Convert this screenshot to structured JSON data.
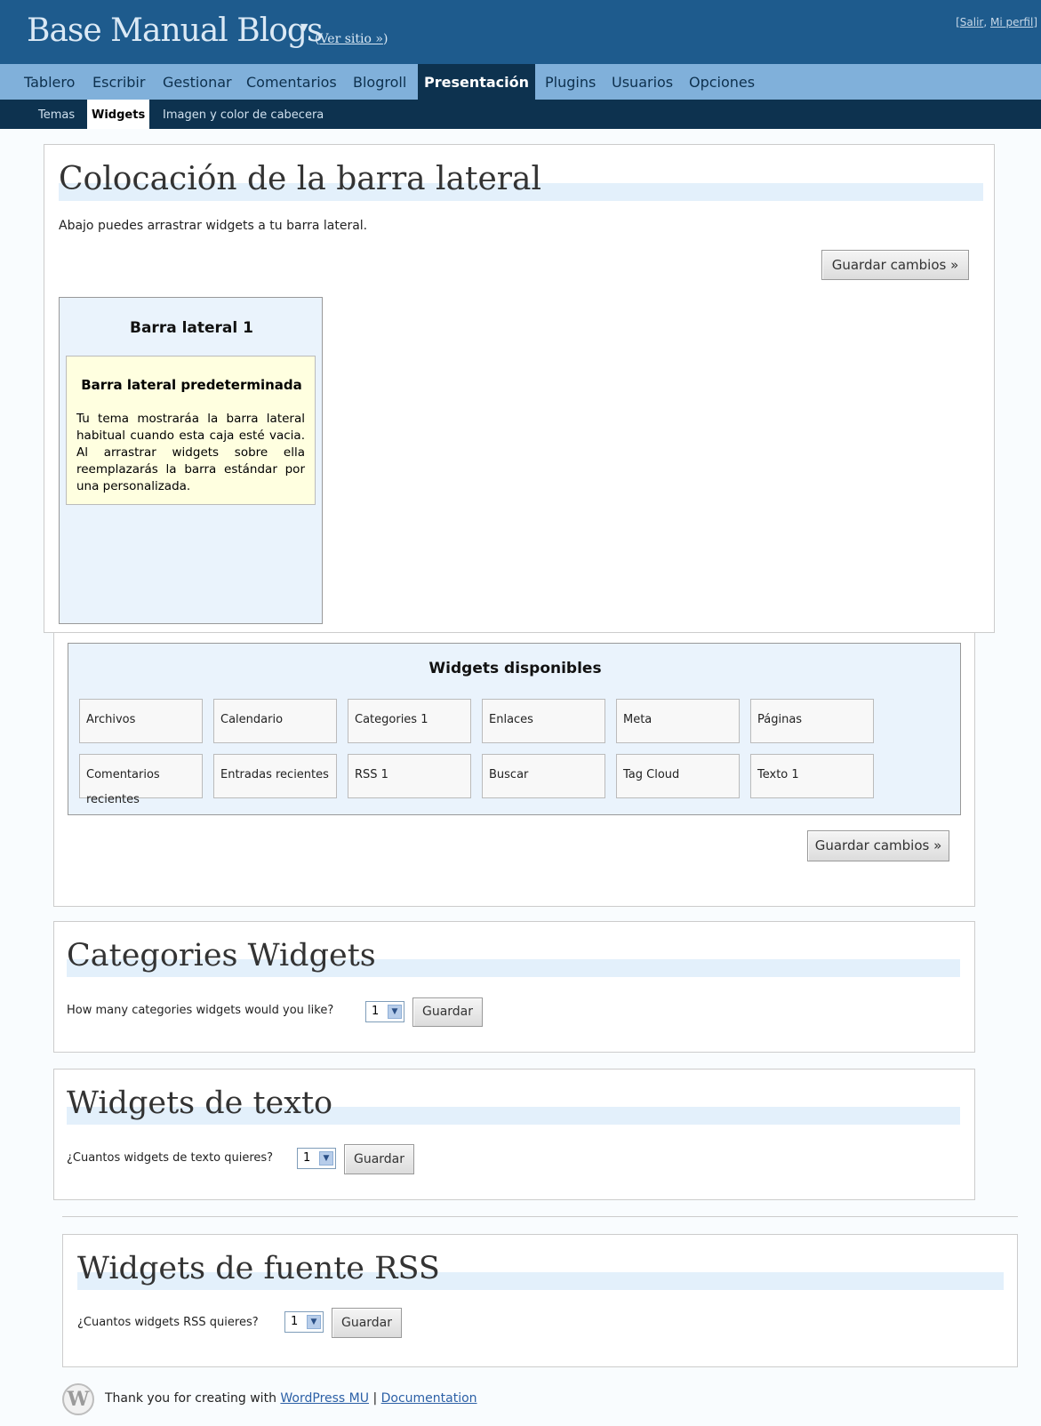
{
  "header": {
    "site_title": "Base Manual Blogs",
    "view_site": "(Ver sitio »)",
    "view_site_paren_open": "(",
    "view_site_link": "Ver sitio »",
    "view_site_paren_close": ")",
    "user_links_open": "[",
    "logout": "Salir",
    "sep": ", ",
    "profile": "Mi perfil",
    "user_links_close": "]"
  },
  "main_nav": [
    "Tablero",
    "Escribir",
    "Gestionar",
    "Comentarios",
    "Blogroll",
    "Presentación",
    "Plugins",
    "Usuarios",
    "Opciones"
  ],
  "main_nav_active": "Presentación",
  "sub_nav": [
    "Temas",
    "Widgets",
    "Imagen y color de cabecera"
  ],
  "sub_nav_active": "Widgets",
  "sidebar_placement": {
    "title": "Colocación de la barra lateral",
    "description": "Abajo puedes arrastrar widgets a tu barra lateral.",
    "save_label": "Guardar cambios »",
    "sidebar_title": "Barra lateral 1",
    "default_title": "Barra lateral predeterminada",
    "default_text": "Tu tema mostraráa la barra lateral habitual cuando esta caja esté vacia. Al arrastrar widgets sobre ella reemplazarás la barra estándar por una personalizada."
  },
  "available_widgets": {
    "title": "Widgets disponibles",
    "row1": [
      "Archivos",
      "Calendario",
      "Categories 1",
      "Enlaces",
      "Meta",
      "Páginas"
    ],
    "row2": [
      "Comentarios recientes",
      "Entradas recientes",
      "RSS 1",
      "Buscar",
      "Tag Cloud",
      "Texto 1"
    ],
    "save_label": "Guardar cambios »"
  },
  "categories_widgets": {
    "title": "Categories Widgets",
    "question": "How many categories widgets would you like?",
    "selected": "1",
    "save_label": "Guardar"
  },
  "text_widgets": {
    "title": "Widgets de texto",
    "question": "¿Cuantos widgets de texto quieres?",
    "selected": "1",
    "save_label": "Guardar"
  },
  "rss_widgets": {
    "title": "Widgets de fuente RSS",
    "question": "¿Cuantos widgets RSS quieres?",
    "selected": "1",
    "save_label": "Guardar"
  },
  "footer": {
    "text_before": "Thank you for creating with ",
    "wpmu_link": "WordPress MU",
    "separator": " | ",
    "doc_link": "Documentation"
  }
}
